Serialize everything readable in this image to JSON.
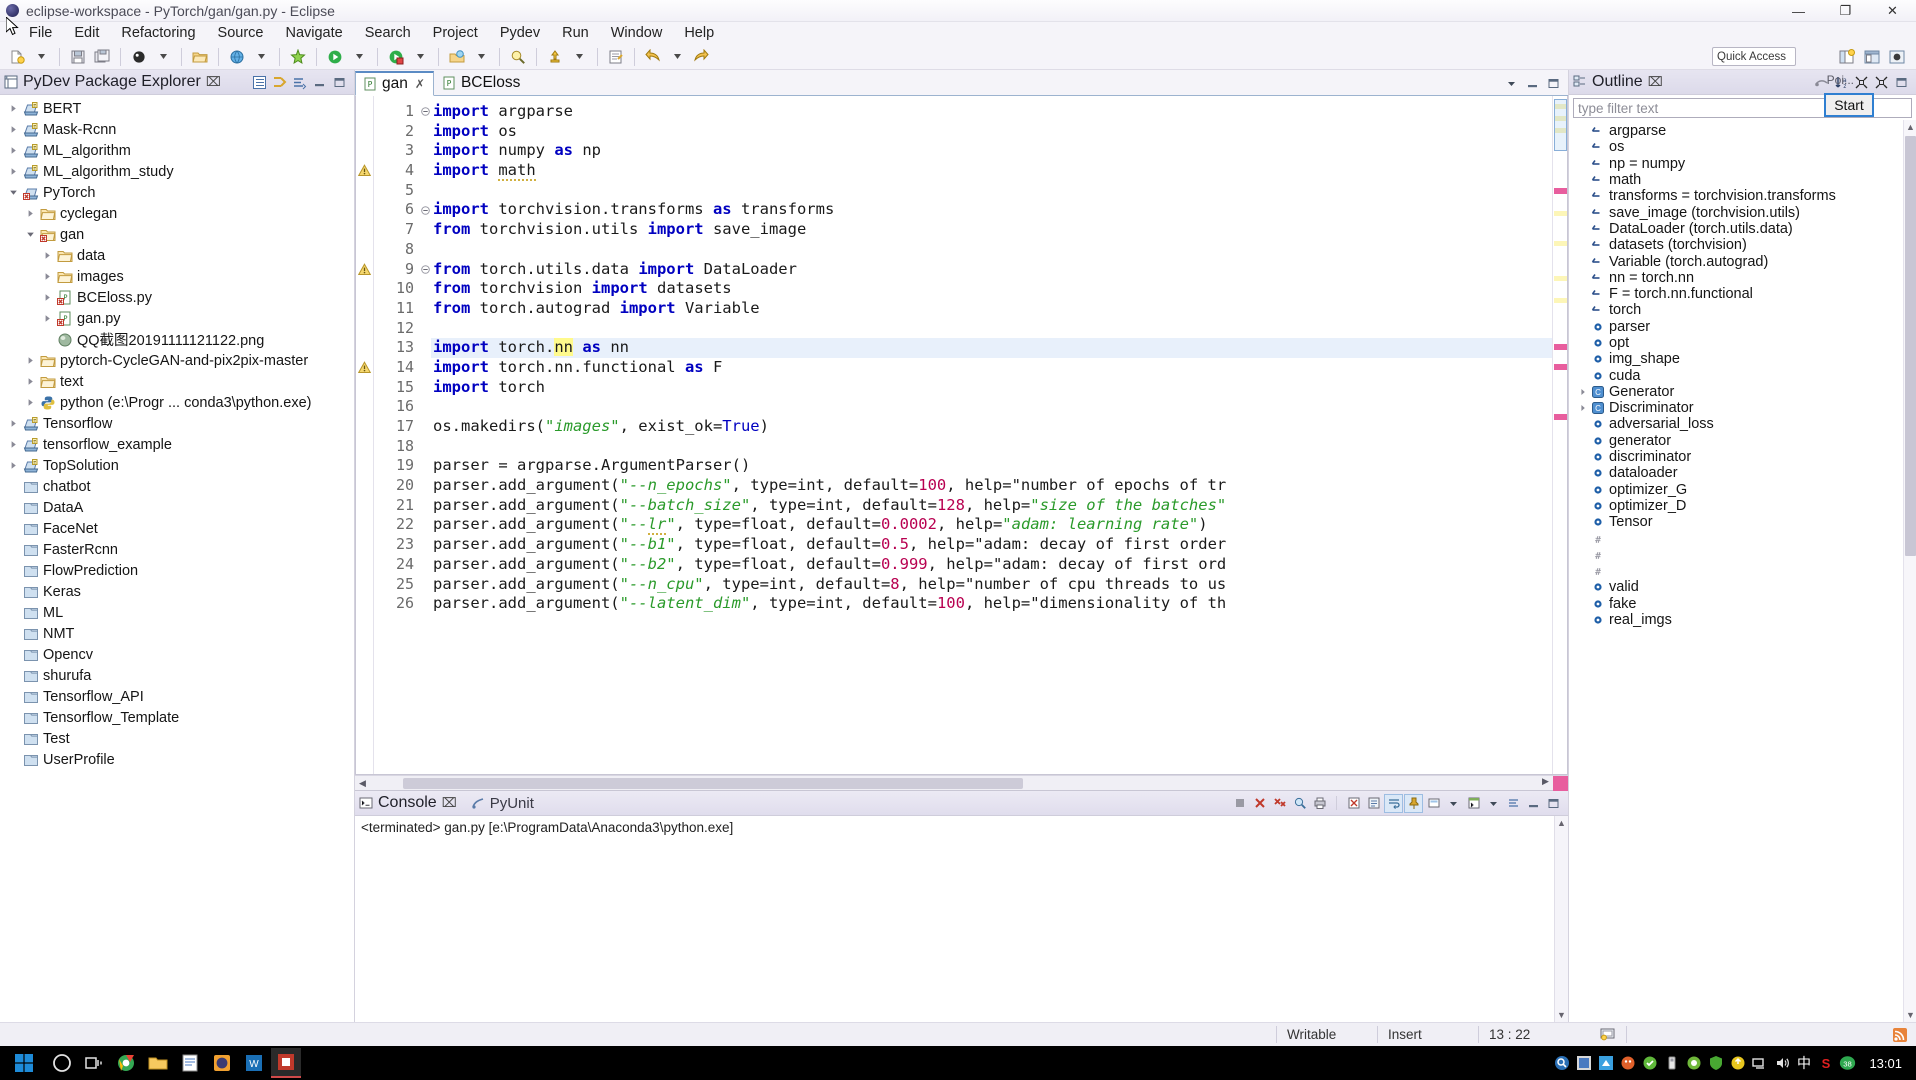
{
  "window": {
    "title": "eclipse-workspace - PyTorch/gan/gan.py - Eclipse",
    "minimize": "—",
    "maximize": "❐",
    "close": "✕"
  },
  "menubar": [
    {
      "label": "File"
    },
    {
      "label": "Edit"
    },
    {
      "label": "Refactoring"
    },
    {
      "label": "Source"
    },
    {
      "label": "Navigate"
    },
    {
      "label": "Search"
    },
    {
      "label": "Project"
    },
    {
      "label": "Pydev"
    },
    {
      "label": "Run"
    },
    {
      "label": "Window"
    },
    {
      "label": "Help"
    }
  ],
  "toolbar": {
    "quick_access": "Quick Access",
    "perspective_label": "Poi..."
  },
  "explorer": {
    "title": "PyDev Package Explorer",
    "close_glyph": "⌧",
    "tools": [
      "collapse-all-icon",
      "link-with-editor-icon",
      "view-menu-icon",
      "minimize-icon",
      "maximize-icon"
    ],
    "tree": [
      {
        "label": "BERT",
        "depth": 0,
        "arrow": "right",
        "icon": "project-py"
      },
      {
        "label": "Mask-Rcnn",
        "depth": 0,
        "arrow": "right",
        "icon": "project-py"
      },
      {
        "label": "ML_algorithm",
        "depth": 0,
        "arrow": "right",
        "icon": "project-py"
      },
      {
        "label": "ML_algorithm_study",
        "depth": 0,
        "arrow": "right",
        "icon": "project-py"
      },
      {
        "label": "PyTorch",
        "depth": 0,
        "arrow": "down",
        "icon": "project-py-err"
      },
      {
        "label": "cyclegan",
        "depth": 1,
        "arrow": "right",
        "icon": "folder"
      },
      {
        "label": "gan",
        "depth": 1,
        "arrow": "down",
        "icon": "folder-err"
      },
      {
        "label": "data",
        "depth": 2,
        "arrow": "right",
        "icon": "folder"
      },
      {
        "label": "images",
        "depth": 2,
        "arrow": "right",
        "icon": "folder"
      },
      {
        "label": "BCEloss.py",
        "depth": 2,
        "arrow": "right",
        "icon": "pyfile-err"
      },
      {
        "label": "gan.py",
        "depth": 2,
        "arrow": "right",
        "icon": "pyfile-err"
      },
      {
        "label": "QQ截图20191111121122.png",
        "depth": 2,
        "arrow": "none",
        "icon": "image"
      },
      {
        "label": "pytorch-CycleGAN-and-pix2pix-master",
        "depth": 1,
        "arrow": "right",
        "icon": "folder"
      },
      {
        "label": "text",
        "depth": 1,
        "arrow": "right",
        "icon": "folder"
      },
      {
        "label": "python  (e:\\Progr ... conda3\\python.exe)",
        "depth": 1,
        "arrow": "right",
        "icon": "python"
      },
      {
        "label": "Tensorflow",
        "depth": 0,
        "arrow": "right",
        "icon": "project-py"
      },
      {
        "label": "tensorflow_example",
        "depth": 0,
        "arrow": "right",
        "icon": "project-py"
      },
      {
        "label": "TopSolution",
        "depth": 0,
        "arrow": "right",
        "icon": "project-py"
      },
      {
        "label": "chatbot",
        "depth": 0,
        "arrow": "none",
        "icon": "closed-project"
      },
      {
        "label": "DataA",
        "depth": 0,
        "arrow": "none",
        "icon": "closed-project"
      },
      {
        "label": "FaceNet",
        "depth": 0,
        "arrow": "none",
        "icon": "closed-project"
      },
      {
        "label": "FasterRcnn",
        "depth": 0,
        "arrow": "none",
        "icon": "closed-project"
      },
      {
        "label": "FlowPrediction",
        "depth": 0,
        "arrow": "none",
        "icon": "closed-project"
      },
      {
        "label": "Keras",
        "depth": 0,
        "arrow": "none",
        "icon": "closed-project"
      },
      {
        "label": "ML",
        "depth": 0,
        "arrow": "none",
        "icon": "closed-project"
      },
      {
        "label": "NMT",
        "depth": 0,
        "arrow": "none",
        "icon": "closed-project"
      },
      {
        "label": "Opencv",
        "depth": 0,
        "arrow": "none",
        "icon": "closed-project"
      },
      {
        "label": "shurufa",
        "depth": 0,
        "arrow": "none",
        "icon": "closed-project"
      },
      {
        "label": "Tensorflow_API",
        "depth": 0,
        "arrow": "none",
        "icon": "closed-project"
      },
      {
        "label": "Tensorflow_Template",
        "depth": 0,
        "arrow": "none",
        "icon": "closed-project"
      },
      {
        "label": "Test",
        "depth": 0,
        "arrow": "none",
        "icon": "closed-project"
      },
      {
        "label": "UserProfile",
        "depth": 0,
        "arrow": "none",
        "icon": "closed-project"
      }
    ]
  },
  "editor": {
    "tabs": [
      {
        "label": "gan",
        "active": true,
        "closable": true
      },
      {
        "label": "BCEloss",
        "active": false,
        "closable": false
      }
    ],
    "lines": [
      {
        "n": 1,
        "fold": true,
        "marker": "",
        "highlight": false
      },
      {
        "n": 2,
        "fold": false,
        "marker": "",
        "highlight": false
      },
      {
        "n": 3,
        "fold": false,
        "marker": "",
        "highlight": false
      },
      {
        "n": 4,
        "fold": false,
        "marker": "warn",
        "highlight": false
      },
      {
        "n": 5,
        "fold": false,
        "marker": "",
        "highlight": false
      },
      {
        "n": 6,
        "fold": true,
        "marker": "",
        "highlight": false
      },
      {
        "n": 7,
        "fold": false,
        "marker": "",
        "highlight": false
      },
      {
        "n": 8,
        "fold": false,
        "marker": "",
        "highlight": false
      },
      {
        "n": 9,
        "fold": true,
        "marker": "warn",
        "highlight": false
      },
      {
        "n": 10,
        "fold": false,
        "marker": "",
        "highlight": false
      },
      {
        "n": 11,
        "fold": false,
        "marker": "",
        "highlight": false
      },
      {
        "n": 12,
        "fold": false,
        "marker": "",
        "highlight": false
      },
      {
        "n": 13,
        "fold": false,
        "marker": "",
        "highlight": true
      },
      {
        "n": 14,
        "fold": false,
        "marker": "warn",
        "highlight": false
      },
      {
        "n": 15,
        "fold": false,
        "marker": "",
        "highlight": false
      },
      {
        "n": 16,
        "fold": false,
        "marker": "",
        "highlight": false
      },
      {
        "n": 17,
        "fold": false,
        "marker": "",
        "highlight": false
      },
      {
        "n": 18,
        "fold": false,
        "marker": "",
        "highlight": false
      },
      {
        "n": 19,
        "fold": false,
        "marker": "",
        "highlight": false
      },
      {
        "n": 20,
        "fold": false,
        "marker": "",
        "highlight": false
      },
      {
        "n": 21,
        "fold": false,
        "marker": "",
        "highlight": false
      },
      {
        "n": 22,
        "fold": false,
        "marker": "",
        "highlight": false
      },
      {
        "n": 23,
        "fold": false,
        "marker": "",
        "highlight": false
      },
      {
        "n": 24,
        "fold": false,
        "marker": "",
        "highlight": false
      },
      {
        "n": 25,
        "fold": false,
        "marker": "",
        "highlight": false
      },
      {
        "n": 26,
        "fold": false,
        "marker": "",
        "highlight": false
      }
    ],
    "source": [
      "import argparse",
      "import os",
      "import numpy as np",
      "import math",
      "",
      "import torchvision.transforms as transforms",
      "from torchvision.utils import save_image",
      "",
      "from torch.utils.data import DataLoader",
      "from torchvision import datasets",
      "from torch.autograd import Variable",
      "",
      "import torch.nn as nn",
      "import torch.nn.functional as F",
      "import torch",
      "",
      "os.makedirs(\"images\", exist_ok=True)",
      "",
      "parser = argparse.ArgumentParser()",
      "parser.add_argument(\"--n_epochs\", type=int, default=100, help=\"number of epochs of tr",
      "parser.add_argument(\"--batch_size\", type=int, default=128, help=\"size of the batches\"",
      "parser.add_argument(\"--lr\", type=float, default=0.0002, help=\"adam: learning rate\")",
      "parser.add_argument(\"--b1\", type=float, default=0.5, help=\"adam: decay of first order",
      "parser.add_argument(\"--b2\", type=float, default=0.999, help=\"adam: decay of first ord",
      "parser.add_argument(\"--n_cpu\", type=int, default=8, help=\"number of cpu threads to us",
      "parser.add_argument(\"--latent_dim\", type=int, default=100, help=\"dimensionality of th"
    ],
    "selected_token": "nn"
  },
  "console": {
    "tabs": [
      {
        "label": "Console",
        "active": true,
        "close_glyph": "⌧"
      },
      {
        "label": "PyUnit",
        "active": false,
        "close_glyph": ""
      }
    ],
    "status_line": "<terminated> gan.py [e:\\ProgramData\\Anaconda3\\python.exe]",
    "tools": [
      "terminate-icon",
      "remove-launch-icon",
      "remove-all-icon",
      "search-icon",
      "print-icon",
      "clear-icon",
      "scroll-lock-icon",
      "word-wrap-icon",
      "pin-icon",
      "display-selected-icon",
      "open-console-icon",
      "view-menu-icon",
      "minimize-icon",
      "maximize-icon"
    ]
  },
  "outline": {
    "title": "Outline",
    "close_glyph": "⌧",
    "filter_placeholder": "type filter text",
    "tools": [
      "focus-icon",
      "sort-icon",
      "collapse-all-icon",
      "expand-all-icon"
    ],
    "items": [
      {
        "label": "argparse",
        "icon": "import",
        "arrow": "none"
      },
      {
        "label": "os",
        "icon": "import",
        "arrow": "none"
      },
      {
        "label": "np = numpy",
        "icon": "import",
        "arrow": "none"
      },
      {
        "label": "math",
        "icon": "import",
        "arrow": "none"
      },
      {
        "label": "transforms = torchvision.transforms",
        "icon": "import",
        "arrow": "none"
      },
      {
        "label": "save_image (torchvision.utils)",
        "icon": "import",
        "arrow": "none"
      },
      {
        "label": "DataLoader (torch.utils.data)",
        "icon": "import",
        "arrow": "none"
      },
      {
        "label": "datasets (torchvision)",
        "icon": "import",
        "arrow": "none"
      },
      {
        "label": "Variable (torch.autograd)",
        "icon": "import",
        "arrow": "none"
      },
      {
        "label": "nn = torch.nn",
        "icon": "import",
        "arrow": "none"
      },
      {
        "label": "F = torch.nn.functional",
        "icon": "import",
        "arrow": "none"
      },
      {
        "label": "torch",
        "icon": "import",
        "arrow": "none"
      },
      {
        "label": "parser",
        "icon": "attr",
        "arrow": "none"
      },
      {
        "label": "opt",
        "icon": "attr",
        "arrow": "none"
      },
      {
        "label": "img_shape",
        "icon": "attr",
        "arrow": "none"
      },
      {
        "label": "cuda",
        "icon": "attr",
        "arrow": "none"
      },
      {
        "label": "Generator",
        "icon": "class",
        "arrow": "right"
      },
      {
        "label": "Discriminator",
        "icon": "class",
        "arrow": "right"
      },
      {
        "label": "adversarial_loss",
        "icon": "attr",
        "arrow": "none"
      },
      {
        "label": "generator",
        "icon": "attr",
        "arrow": "none"
      },
      {
        "label": "discriminator",
        "icon": "attr",
        "arrow": "none"
      },
      {
        "label": "dataloader",
        "icon": "attr",
        "arrow": "none"
      },
      {
        "label": "optimizer_G",
        "icon": "attr",
        "arrow": "none"
      },
      {
        "label": "optimizer_D",
        "icon": "attr",
        "arrow": "none"
      },
      {
        "label": "Tensor",
        "icon": "attr",
        "arrow": "none"
      },
      {
        "label": "",
        "icon": "hash",
        "arrow": "none"
      },
      {
        "label": "",
        "icon": "hash",
        "arrow": "none"
      },
      {
        "label": "",
        "icon": "hash",
        "arrow": "none"
      },
      {
        "label": "valid",
        "icon": "attr",
        "arrow": "none"
      },
      {
        "label": "fake",
        "icon": "attr",
        "arrow": "none"
      },
      {
        "label": "real_imgs",
        "icon": "attr",
        "arrow": "none"
      }
    ]
  },
  "tooltip": {
    "start_label": "Start"
  },
  "statusbar": {
    "writable": "Writable",
    "insert": "Insert",
    "position": "13 : 22"
  },
  "taskbar": {
    "clock": "13:01",
    "ime": "中",
    "badge": "38"
  }
}
